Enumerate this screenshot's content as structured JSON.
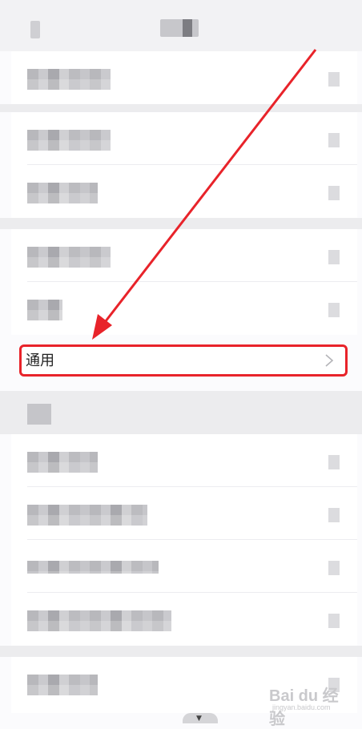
{
  "general_row": {
    "label": "通用"
  },
  "watermark": {
    "brand": "Bai du 经验",
    "url": "jingyan.baidu.com"
  },
  "colors": {
    "highlight": "#e8232a",
    "arrow": "#e8232a",
    "background": "#fbfbfd"
  },
  "icons": {
    "chevron": "chevron-right-icon"
  }
}
